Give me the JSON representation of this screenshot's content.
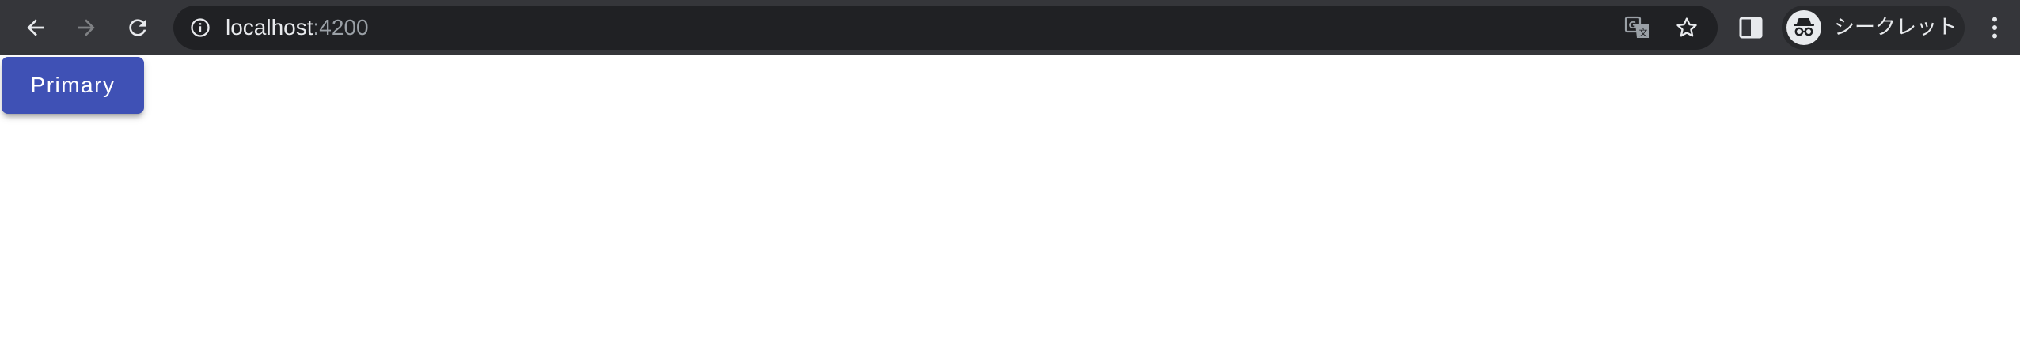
{
  "browser": {
    "url_host": "localhost",
    "url_port": ":4200",
    "profile_label": "シークレット",
    "icons": {
      "back": "arrow-left-icon",
      "forward": "arrow-right-icon",
      "reload": "reload-icon",
      "info": "info-icon",
      "translate": "translate-icon",
      "bookmark": "star-icon",
      "side_panel": "side-panel-icon",
      "incognito": "incognito-icon",
      "menu": "kebab-menu-icon"
    },
    "colors": {
      "toolbar": "#35363a",
      "omnibox": "#202124"
    }
  },
  "page": {
    "primary_button_label": "Primary",
    "colors": {
      "primary": "#3f51b5"
    }
  }
}
